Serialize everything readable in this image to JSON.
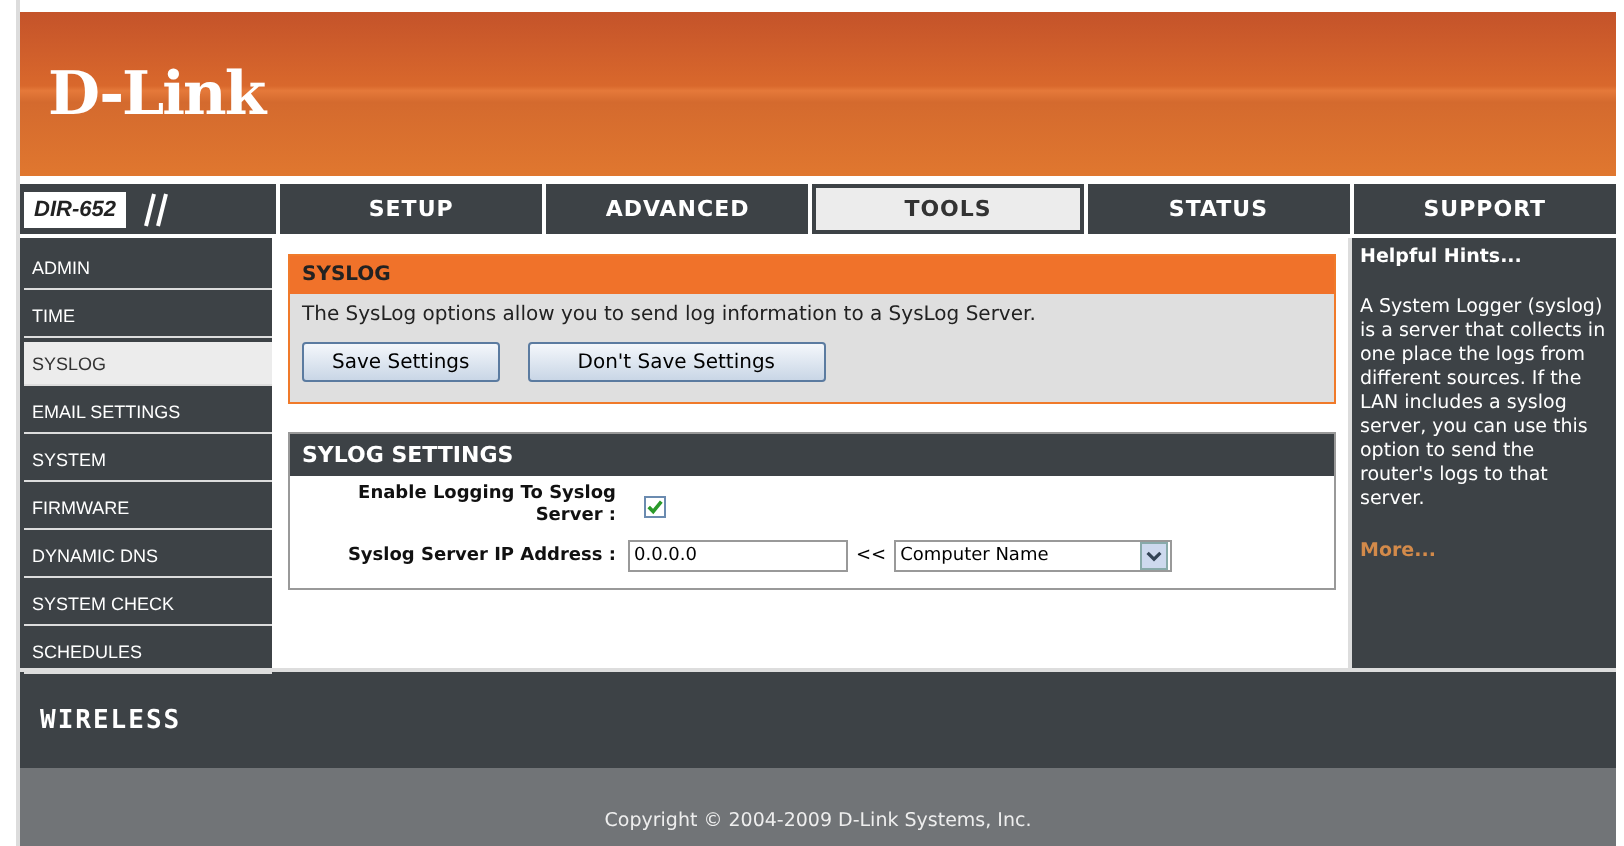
{
  "header": {
    "logo": "D-Link"
  },
  "model": "DIR-652",
  "tabs": [
    {
      "label": "SETUP",
      "selected": false
    },
    {
      "label": "ADVANCED",
      "selected": false
    },
    {
      "label": "TOOLS",
      "selected": true
    },
    {
      "label": "STATUS",
      "selected": false
    },
    {
      "label": "SUPPORT",
      "selected": false
    }
  ],
  "sidebar": {
    "items": [
      {
        "label": "ADMIN",
        "selected": false
      },
      {
        "label": "TIME",
        "selected": false
      },
      {
        "label": "SYSLOG",
        "selected": true
      },
      {
        "label": "EMAIL SETTINGS",
        "selected": false
      },
      {
        "label": "SYSTEM",
        "selected": false
      },
      {
        "label": "FIRMWARE",
        "selected": false
      },
      {
        "label": "DYNAMIC DNS",
        "selected": false
      },
      {
        "label": "SYSTEM CHECK",
        "selected": false
      },
      {
        "label": "SCHEDULES",
        "selected": false
      }
    ]
  },
  "intro": {
    "title": "SYSLOG",
    "text": "The SysLog options allow you to send log information to a SysLog Server.",
    "buttons": [
      "Save Settings",
      "Don't Save Settings"
    ]
  },
  "settings": {
    "title": "SYLOG SETTINGS",
    "enable_label": "Enable Logging To Syslog Server :",
    "enable_checked": true,
    "ip_label": "Syslog Server IP Address :",
    "ip_value": "0.0.0.0",
    "arrows": "<<",
    "computer_select": "Computer Name"
  },
  "hints": {
    "title": "Helpful Hints...",
    "text": "A System Logger (syslog) is a server that collects in one place the logs from different sources. If the LAN includes a syslog server, you can use this option to send the router's logs to that server.",
    "more": "More..."
  },
  "wireless": "WIRELESS",
  "copyright": "Copyright © 2004-2009 D-Link Systems, Inc."
}
